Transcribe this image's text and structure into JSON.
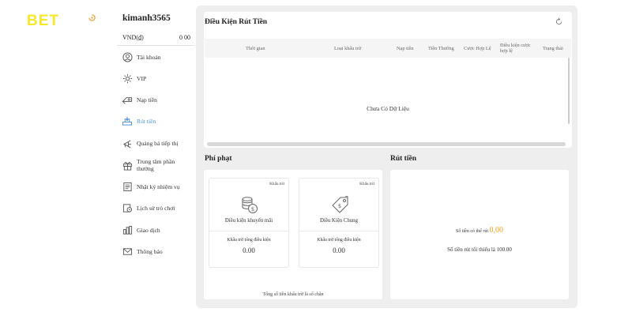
{
  "logo": {
    "text": "BET",
    "color": "#f6e82a"
  },
  "user": {
    "username": "kimanh3565",
    "balance_label": "VND(₫)",
    "balance_value": "0 00"
  },
  "menu": [
    {
      "label": "Tài khoản",
      "icon": "user-icon"
    },
    {
      "label": "VIP",
      "icon": "gear-icon"
    },
    {
      "label": "Nạp tiền",
      "icon": "deposit-icon"
    },
    {
      "label": "Rút tiền",
      "icon": "withdraw-icon",
      "active": true
    },
    {
      "label": "Quảng bá tiếp thị",
      "icon": "share-icon"
    },
    {
      "label": "Trung tâm phần thưởng",
      "icon": "gift-icon"
    },
    {
      "label": "Nhật ký nhiệm vụ",
      "icon": "task-icon"
    },
    {
      "label": "Lịch sử trò chơi",
      "icon": "history-icon"
    },
    {
      "label": "Giao dịch",
      "icon": "transaction-icon"
    },
    {
      "label": "Thông báo",
      "icon": "mail-icon"
    }
  ],
  "withdraw_conditions": {
    "title": "Điều Kiện Rút Tiền",
    "columns": [
      "Thời gian",
      "Loại khấu trừ",
      "Nạp tiền",
      "Tiền Thưởng",
      "Cược Hợp Lệ",
      "Điều kiện cược hợp lệ",
      "Trạng thái"
    ],
    "empty_text": "Chưa Có Dữ Liệu"
  },
  "penalty": {
    "title": "Phí phạt",
    "cards": [
      {
        "tag": "Khấu trừ",
        "label": "Điều kiện khuyến mãi",
        "sub_label": "Khấu trừ tổng điều kiện",
        "value": "0.00",
        "icon": "coins-icon"
      },
      {
        "tag": "Khấu trừ",
        "label": "Điều Kiện Chung",
        "sub_label": "Khấu trừ tổng điều kiện",
        "value": "0.00",
        "icon": "price-tag-icon"
      }
    ],
    "note": "Tổng số tiền khấu trừ là số chẵn"
  },
  "withdraw": {
    "title": "Rút tiền",
    "available_label": "Số tiền có thể rút",
    "available_value": "0,00",
    "min_text": "Số tiền rút tối thiểu là 100.00",
    "accent_color": "#f0a020"
  }
}
